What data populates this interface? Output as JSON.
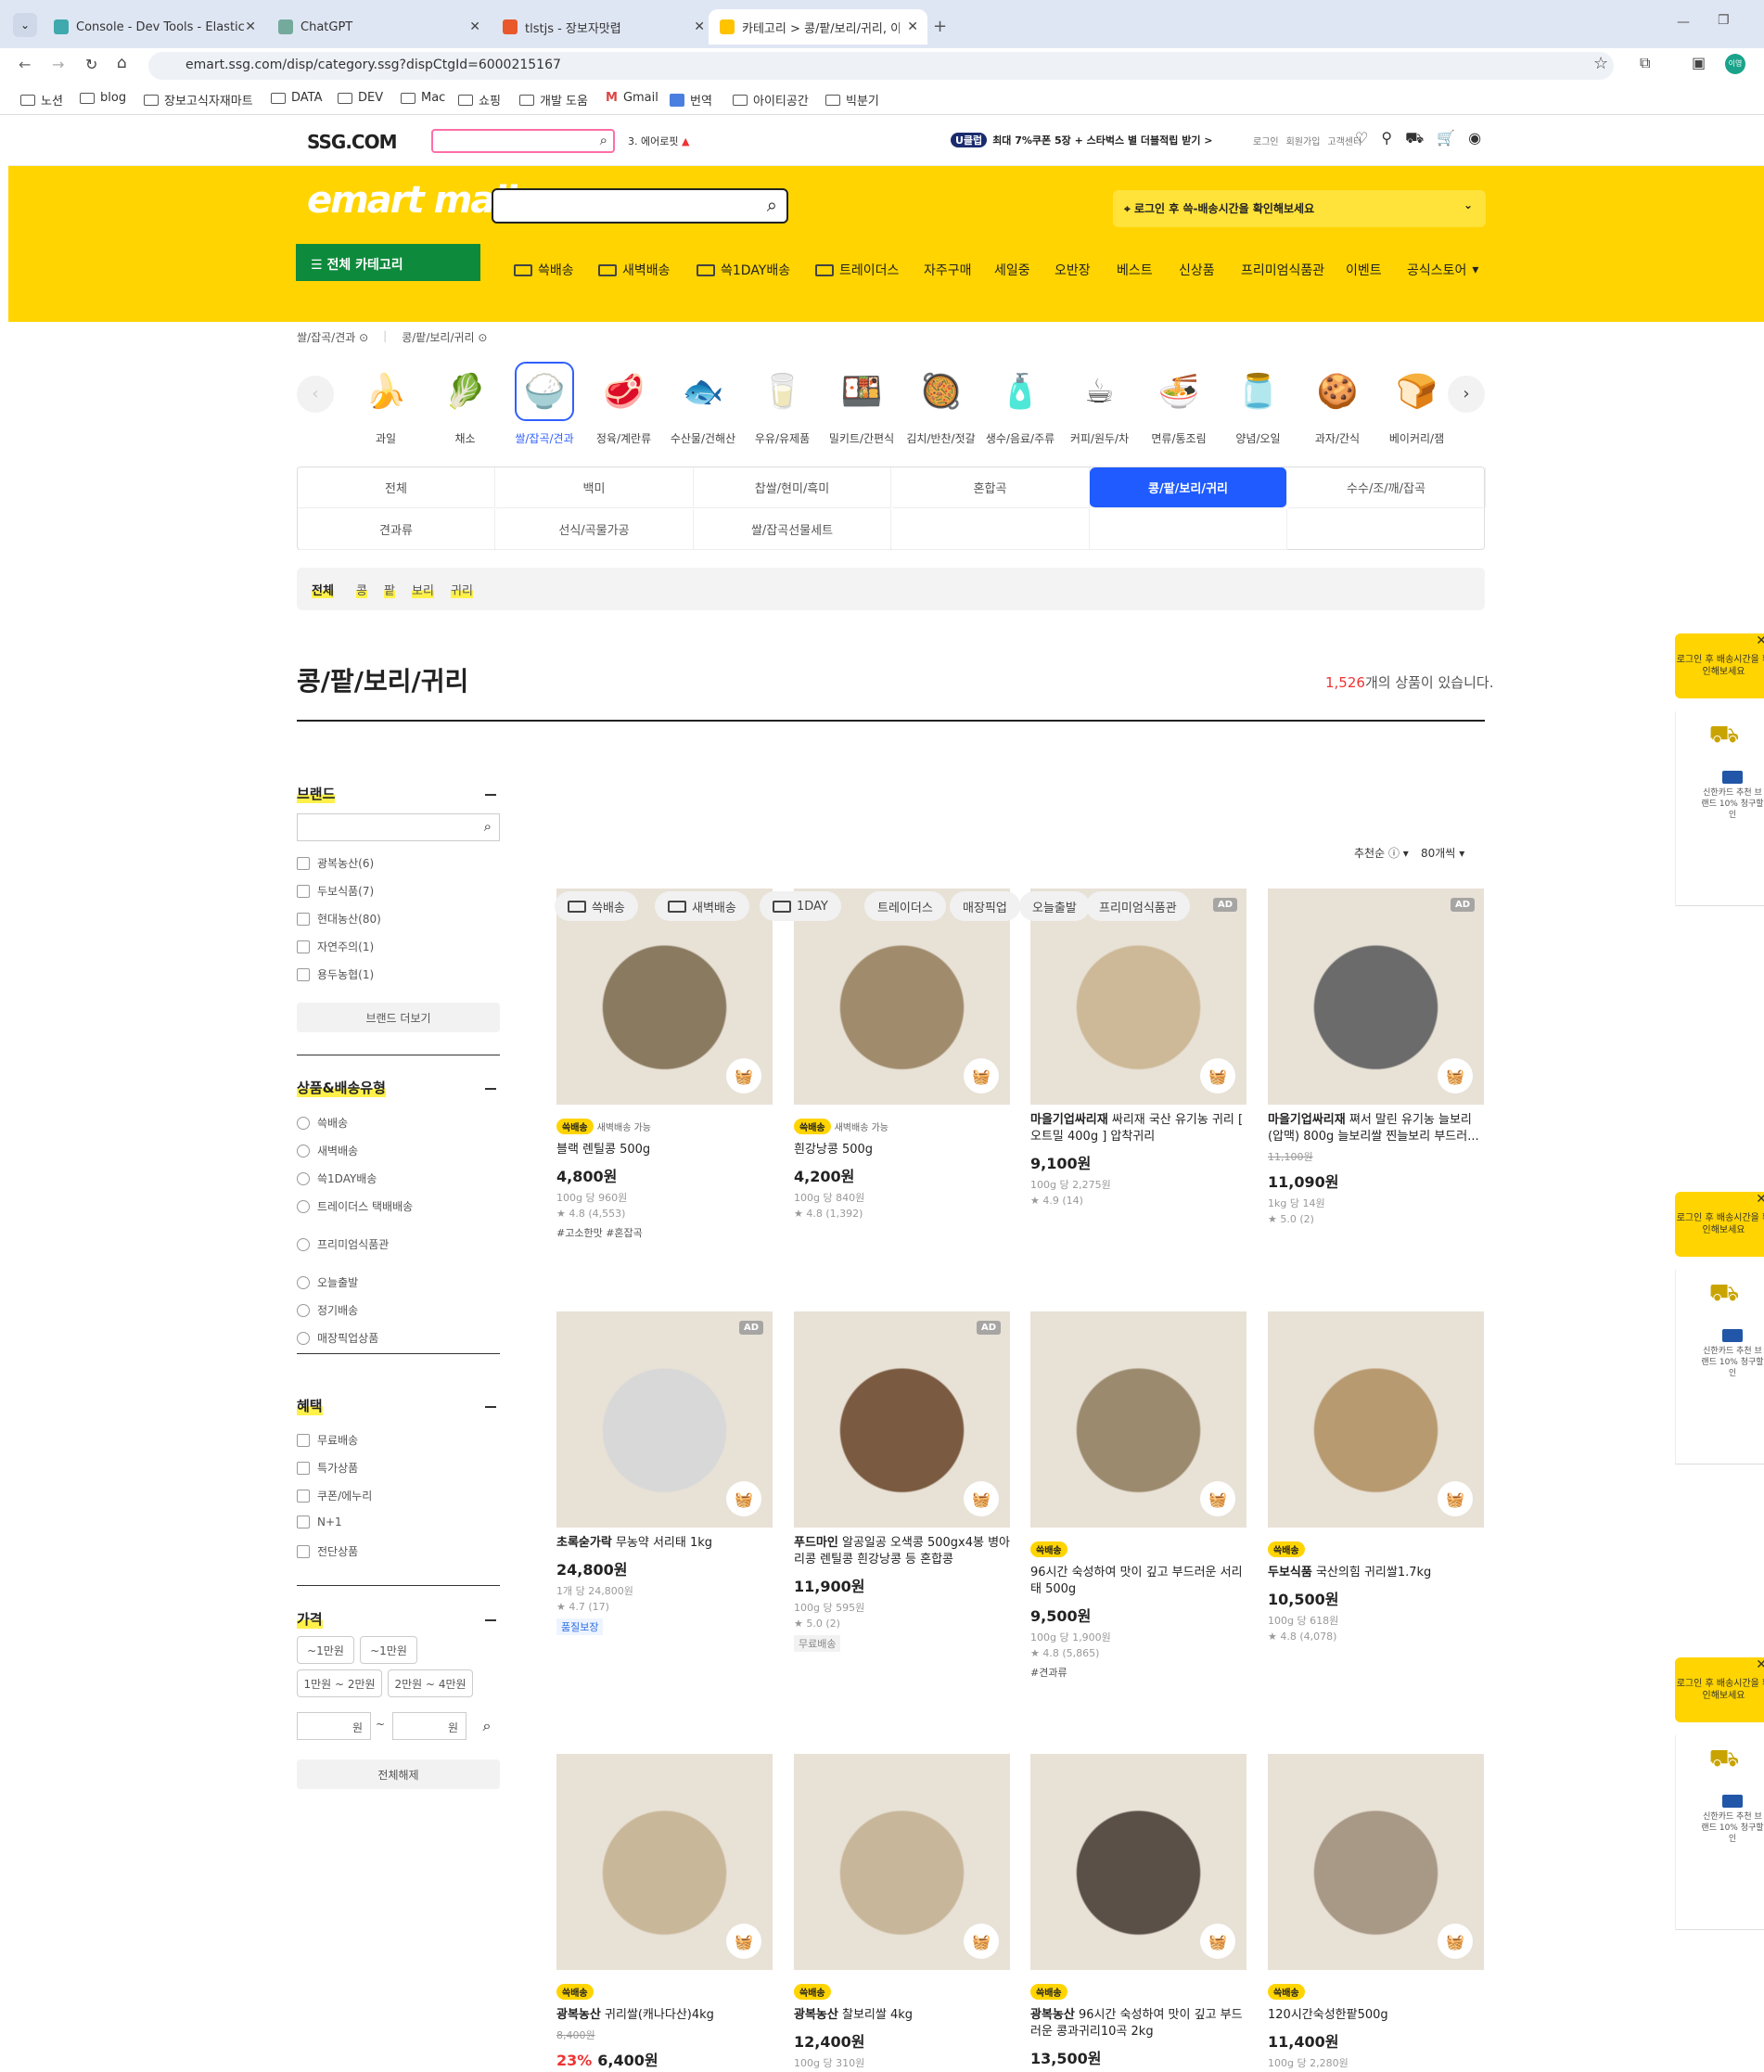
{
  "browser": {
    "tabs": [
      {
        "title": "Console - Dev Tools - Elastic"
      },
      {
        "title": "ChatGPT"
      },
      {
        "title": "tlstjs - 장보자맛렵"
      },
      {
        "title": "카테고리 > 콩/팥/보리/귀리, 이"
      }
    ],
    "url": "emart.ssg.com/disp/category.ssg?dispCtgId=6000215167",
    "bookmarks": [
      "노션",
      "blog",
      "장보고식자재마트",
      "DATA",
      "DEV",
      "Mac",
      "쇼핑",
      "개발 도움",
      "Gmail",
      "번역",
      "아이티공간",
      "빅분기"
    ],
    "profile": "이영"
  },
  "ssg": {
    "logo": "SSG.COM",
    "trend": "3. 에어로핏",
    "promo_badge": "U클럽",
    "promo": "최대 7%쿠폰 5장 + 스타벅스 별 더블적립 받기 >",
    "login": "로그인",
    "join": "회원가입",
    "cs": "고객센터"
  },
  "emart": {
    "logo": "emart mall",
    "delivery_prompt": "로그인 후 쓱-배송시간을 확인해보세요",
    "all_categories": "전체 카테고리",
    "menu": [
      "쓱배송",
      "새벽배송",
      "쓱1DAY배송",
      "트레이더스",
      "자주구매",
      "세일중",
      "오반장",
      "베스트",
      "신상품",
      "프리미엄식품관",
      "이벤트",
      "공식스토어"
    ]
  },
  "breadcrumb": [
    "쌀/잡곡/견과",
    "콩/팥/보리/귀리"
  ],
  "categories": [
    {
      "label": "과일",
      "icon": "🍌"
    },
    {
      "label": "채소",
      "icon": "🥬"
    },
    {
      "label": "쌀/잡곡/견과",
      "icon": "🍚"
    },
    {
      "label": "정육/계란류",
      "icon": "🥩"
    },
    {
      "label": "수산물/건해산",
      "icon": "🐟"
    },
    {
      "label": "우유/유제품",
      "icon": "🥛"
    },
    {
      "label": "밀키트/간편식",
      "icon": "🍱"
    },
    {
      "label": "김치/반찬/젓갈",
      "icon": "🥘"
    },
    {
      "label": "생수/음료/주류",
      "icon": "🧴"
    },
    {
      "label": "커피/원두/차",
      "icon": "☕"
    },
    {
      "label": "면류/통조림",
      "icon": "🍜"
    },
    {
      "label": "양념/오일",
      "icon": "🫙"
    },
    {
      "label": "과자/간식",
      "icon": "🍪"
    },
    {
      "label": "베이커리/잼",
      "icon": "🍞"
    }
  ],
  "subcategories": [
    [
      "전체",
      "백미",
      "찹쌀/현미/흑미",
      "혼합곡",
      "콩/팥/보리/귀리",
      "수수/조/깨/잡곡"
    ],
    [
      "견과류",
      "선식/곡물가공",
      "쌀/잡곡선물세트",
      "",
      ""
    ]
  ],
  "pills": [
    "전체",
    "콩",
    "팥",
    "보리",
    "귀리"
  ],
  "page_title": "콩/팥/보리/귀리",
  "count": {
    "num": "1,526",
    "suffix": "개의 상품이 있습니다."
  },
  "filters": {
    "brand": {
      "title": "브랜드",
      "items": [
        "광복농산(6)",
        "두보식품(7)",
        "현대농산(80)",
        "자연주의(1)",
        "용두농협(1)"
      ],
      "more": "브랜드 더보기"
    },
    "delivery": {
      "title": "상품&배송유형",
      "items": [
        "쓱배송",
        "새벽배송",
        "쓱1DAY배송",
        "트레이더스 택배배송",
        "프리미엄식품관",
        "오늘출발",
        "정기배송",
        "매장픽업상품"
      ]
    },
    "benefit": {
      "title": "혜택",
      "items": [
        "무료배송",
        "특가상품",
        "쿠폰/에누리",
        "N+1",
        "전단상품"
      ]
    },
    "price": {
      "title": "가격",
      "ranges": [
        "~1만원",
        "~1만원",
        "1만원 ~ 2만원",
        "2만원 ~ 4만원"
      ],
      "unit": "원",
      "tilde": "~",
      "reset": "전체해제"
    }
  },
  "chips": [
    "쓱배송",
    "새벽배송",
    "1DAY",
    "트레이더스",
    "매장픽업",
    "오늘출발",
    "프리미엄식품관"
  ],
  "sort": {
    "order": "추천순",
    "per_page": "80개씩"
  },
  "products": [
    {
      "brand": "",
      "name": "블랙 렌틸콩 500g",
      "price": "4,800원",
      "orig": "",
      "unit": "100g 당 960원",
      "rating": "★ 4.8 (4,553)",
      "tags": "#고소한맛   #혼잡곡",
      "ship": "쓱배송",
      "ship2": "새벽배송 가능",
      "ad": false,
      "color": "#8a7a60"
    },
    {
      "brand": "",
      "name": "흰강낭콩 500g",
      "price": "4,200원",
      "orig": "",
      "unit": "100g 당 840원",
      "rating": "★ 4.8 (1,392)",
      "tags": "",
      "ship": "쓱배송",
      "ship2": "새벽배송 가능",
      "ad": false,
      "color": "#a08b6c"
    },
    {
      "brand": "마을기업싸리재",
      "name": "싸리재 국산 유기농 귀리 [ 오트밀 400g ] 압착귀리",
      "price": "9,100원",
      "orig": "",
      "unit": "100g 당 2,275원",
      "rating": "★ 4.9 (14)",
      "tags": "",
      "ship": "",
      "ship2": "",
      "ad": true,
      "color": "#cdb998"
    },
    {
      "brand": "마을기업싸리재",
      "name": "쪄서 말린 유기농 늘보리 (압맥) 800g 늘보리쌀 찐늘보리 부드러...",
      "price": "11,090원",
      "orig": "11,100원",
      "unit": "1kg 당 14원",
      "rating": "★ 5.0 (2)",
      "tags": "",
      "ship": "",
      "ship2": "",
      "ad": true,
      "color": "#6b6b6b"
    },
    {
      "brand": "초록숟가락",
      "name": "무농약 서리태 1kg",
      "price": "24,800원",
      "orig": "",
      "unit": "1개 당 24,800원",
      "rating": "★ 4.7 (17)",
      "tags": "",
      "tag2": "품질보장",
      "ship": "",
      "ship2": "",
      "ad": true,
      "color": "#d8d8d8"
    },
    {
      "brand": "푸드마인",
      "name": "알공일공 오색콩 500gx4봉 병아리콩 렌틸콩 흰강낭콩 등 혼합콩",
      "price": "11,900원",
      "orig": "",
      "unit": "100g 당 595원",
      "rating": "★ 5.0 (2)",
      "tags": "",
      "tag3": "무료배송",
      "ship": "",
      "ship2": "",
      "ad": true,
      "color": "#7a5a40"
    },
    {
      "brand": "",
      "name": "96시간 숙성하여 맛이 깊고 부드러운 서리태 500g",
      "price": "9,500원",
      "orig": "",
      "unit": "100g 당 1,900원",
      "rating": "★ 4.8 (5,865)",
      "tags": "#견과류",
      "ship": "쓱배송",
      "ship2": "",
      "ad": false,
      "color": "#9b8a6e"
    },
    {
      "brand": "두보식품",
      "name": "국산의힘 귀리쌀1.7kg",
      "price": "10,500원",
      "orig": "",
      "unit": "100g 당 618원",
      "rating": "★ 4.8 (4,078)",
      "tags": "",
      "ship": "쓱배송",
      "ship2": "",
      "ad": false,
      "color": "#b89a70"
    },
    {
      "brand": "광복농산",
      "name": "귀리쌀(캐나다산)4kg",
      "price": "6,400원",
      "discount": "23%",
      "orig": "8,400원",
      "unit": "",
      "rating": "",
      "tags": "",
      "ship": "쓱배송",
      "ship2": "",
      "ad": false,
      "color": "#c9b79a"
    },
    {
      "brand": "광복농산",
      "name": "찰보리쌀 4kg",
      "price": "12,400원",
      "orig": "",
      "unit": "100g 당 310원",
      "rating": "",
      "tags": "",
      "ship": "쓱배송",
      "ship2": "",
      "ad": false,
      "color": "#c7b699"
    },
    {
      "brand": "광복농산",
      "name": "96시간 숙성하여 맛이 깊고 부드러운 콩과귀리10곡 2kg",
      "price": "13,500원",
      "orig": "",
      "unit": "",
      "rating": "",
      "tags": "",
      "ship": "쓱배송",
      "ship2": "",
      "ad": false,
      "color": "#5a5048"
    },
    {
      "brand": "",
      "name": "120시간숙성한팥500g",
      "price": "11,400원",
      "orig": "",
      "unit": "100g 당 2,280원",
      "rating": "",
      "tags": "",
      "ship": "쓱배송",
      "ship2": "",
      "ad": false,
      "color": "#a89886"
    }
  ],
  "side": {
    "tip": "로그인 후 배송시간을 확인해보세요",
    "card": "신한카드 추천 브랜드 10% 청구할인"
  }
}
